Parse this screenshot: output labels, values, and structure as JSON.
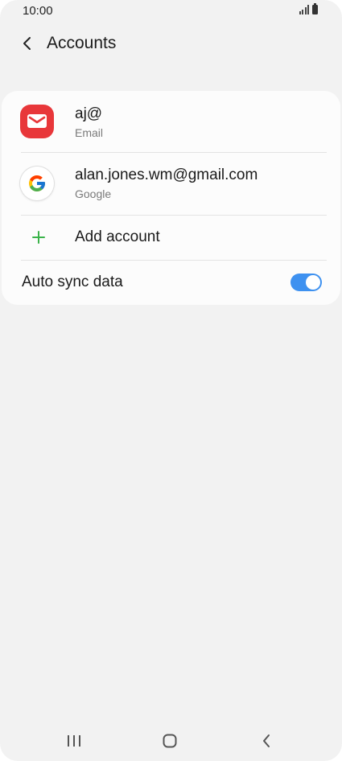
{
  "status_bar": {
    "time": "10:00",
    "signal_icon": "signal-icon",
    "battery_icon": "battery-icon"
  },
  "header": {
    "back_icon": "chevron-left-icon",
    "title": "Accounts"
  },
  "accounts": [
    {
      "name": "aj@",
      "type": "Email",
      "icon": "email-app-icon",
      "icon_color": "#e8373a"
    },
    {
      "name": "alan.jones.wm@gmail.com",
      "type": "Google",
      "icon": "google-icon"
    }
  ],
  "add_account": {
    "label": "Add account",
    "icon": "plus-icon",
    "icon_color": "#3bb34a"
  },
  "auto_sync": {
    "label": "Auto sync data",
    "enabled": true,
    "toggle_color": "#3e91f0"
  },
  "nav_bar": {
    "recent_icon": "recent-apps-icon",
    "home_icon": "home-icon",
    "back_icon": "back-icon"
  }
}
